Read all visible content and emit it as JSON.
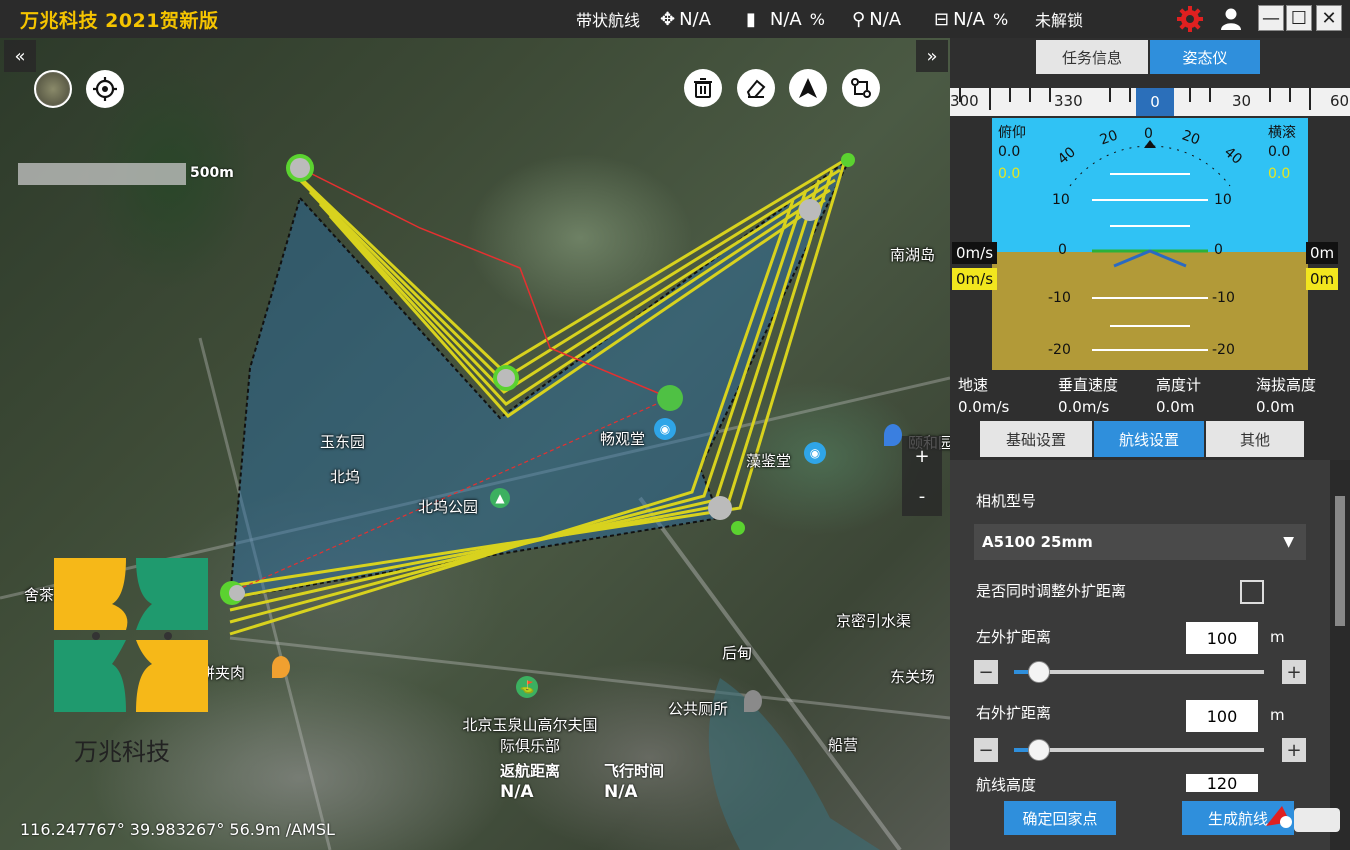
{
  "titlebar": {
    "title": "万兆科技 2021贺新版",
    "mode": "带状航线",
    "sat_value": "N/A",
    "battery_value": "N/A",
    "battery_unit": "%",
    "signal_value": "N/A",
    "rc_value": "N/A",
    "rc_unit": "%",
    "lock_status": "未解锁"
  },
  "map": {
    "scale_label": "500m",
    "labels": {
      "nanhudao": "南湖岛",
      "yudongyuan": "玉东园",
      "beiwu": "北坞",
      "beiwu_park": "北坞公园",
      "changguantang": "畅观堂",
      "yijiantang": "藻鉴堂",
      "yiheyuan": "颐和园南",
      "jingmi": "京密引水渠",
      "dongguan": "东关场",
      "houdian": "后甸",
      "toilet": "公共厕所",
      "golf": "北京玉泉山高尔夫国际俱乐部",
      "chuanying": "船营",
      "roujiamo": "饼夹肉",
      "shelabel": "舍茶"
    },
    "return_distance_label": "返航距离",
    "return_distance_value": "N/A",
    "flight_time_label": "飞行时间",
    "flight_time_value": "N/A",
    "coordinate": "116.247767° 39.983267° 56.9m /AMSL",
    "zoom_in": "+",
    "zoom_out": "-",
    "collapse_left": "«",
    "collapse_right": "»"
  },
  "logo": {
    "text": "万兆科技",
    "colors": [
      "#f6b818",
      "#1f9a6e"
    ]
  },
  "panel": {
    "tabs": [
      "任务信息",
      "姿态仪"
    ],
    "active_tab": "姿态仪",
    "compass": {
      "labels": [
        "300",
        "330",
        "0",
        "30",
        "60"
      ],
      "current": "0"
    },
    "attitude": {
      "pitch_label": "俯仰",
      "pitch_value": "0.0",
      "pitch_target": "0.0",
      "roll_label": "横滚",
      "roll_value": "0.0",
      "roll_target": "0.0",
      "arc_labels": [
        "40",
        "20",
        "0",
        "20",
        "40"
      ],
      "ladder": [
        "10",
        "0",
        "-10",
        "-20"
      ],
      "left_speed": "0m/s",
      "left_speed_target": "0m/s",
      "right_alt": "0m",
      "right_alt_target": "0m",
      "sky_color": "#30c2f4",
      "ground_color": "#b29a38"
    },
    "telemetry": [
      {
        "label": "地速",
        "value": "0.0m/s"
      },
      {
        "label": "垂直速度",
        "value": "0.0m/s"
      },
      {
        "label": "高度计",
        "value": "0.0m"
      },
      {
        "label": "海拔高度",
        "value": "0.0m"
      }
    ],
    "sub_tabs": [
      "基础设置",
      "航线设置",
      "其他"
    ],
    "active_sub_tab": "航线设置",
    "settings": {
      "camera_label": "相机型号",
      "camera_value": "A5100 25mm",
      "sync_label": "是否同时调整外扩距离",
      "left_ext_label": "左外扩距离",
      "left_ext_value": "100",
      "left_ext_unit": "m",
      "left_ext_slider": 0.1,
      "right_ext_label": "右外扩距离",
      "right_ext_value": "100",
      "right_ext_unit": "m",
      "right_ext_slider": 0.1,
      "route_height_label": "航线高度",
      "route_height_value": "120",
      "minus": "−",
      "plus": "+"
    },
    "buttons": {
      "confirm_home": "确定回家点",
      "generate": "生成航线"
    }
  },
  "colors": {
    "accent": "#2f8fdc",
    "title_yellow": "#f5c400",
    "route_yellow": "#d8d21e",
    "route_green": "#5bd230"
  }
}
